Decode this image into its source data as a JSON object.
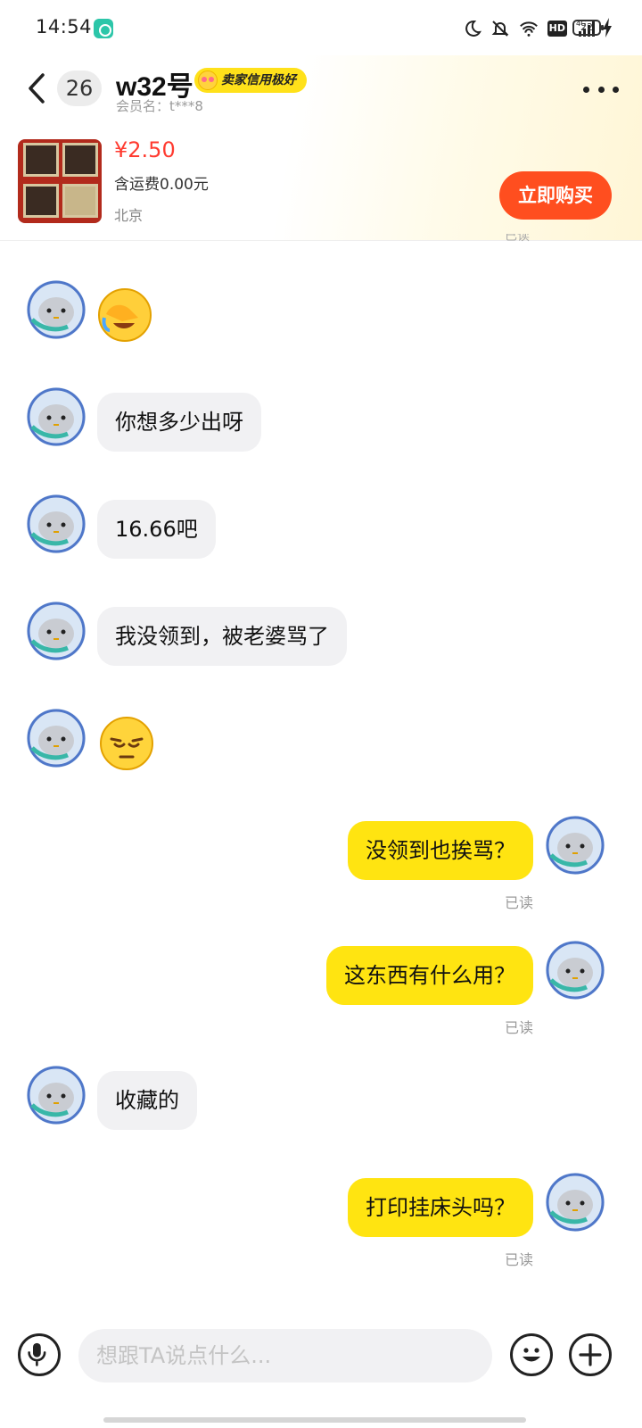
{
  "status_bar": {
    "time": "14:54",
    "network": "4G",
    "battery": "22",
    "hd": "HD"
  },
  "header": {
    "unread_count": "26",
    "seller_name": "w32号",
    "credit_badge": "卖家信用极好",
    "member_id": "会员名：t***8",
    "more_icon": "more-dots-icon"
  },
  "product": {
    "price": "¥2.50",
    "shipping": "含运费0.00元",
    "location": "北京",
    "buy_label": "立即购买"
  },
  "peek_read": "已读",
  "messages": [
    {
      "side": "in",
      "type": "emoji",
      "emoji": "facepalm-crying-emoji"
    },
    {
      "side": "in",
      "type": "text",
      "text": "你想多少出呀"
    },
    {
      "side": "in",
      "type": "text",
      "text": "16.66吧"
    },
    {
      "side": "in",
      "type": "text",
      "text": "我没领到，被老婆骂了"
    },
    {
      "side": "in",
      "type": "emoji",
      "emoji": "pensive-face-emoji"
    },
    {
      "side": "out",
      "type": "text",
      "text": "没领到也挨骂？",
      "status": "已读"
    },
    {
      "side": "out",
      "type": "text",
      "text": "这东西有什么用？",
      "status": "已读"
    },
    {
      "side": "in",
      "type": "text",
      "text": "收藏的"
    },
    {
      "side": "out",
      "type": "text",
      "text": "打印挂床头吗？",
      "status": "已读"
    }
  ],
  "input_bar": {
    "placeholder": "想跟TA说点什么...",
    "voice_icon": "microphone-icon",
    "emoji_icon": "smiley-icon",
    "add_icon": "plus-icon"
  },
  "colors": {
    "accent_yellow": "#ffe411",
    "buy_orange": "#ff4e1f",
    "price_red": "#ff3b30"
  }
}
